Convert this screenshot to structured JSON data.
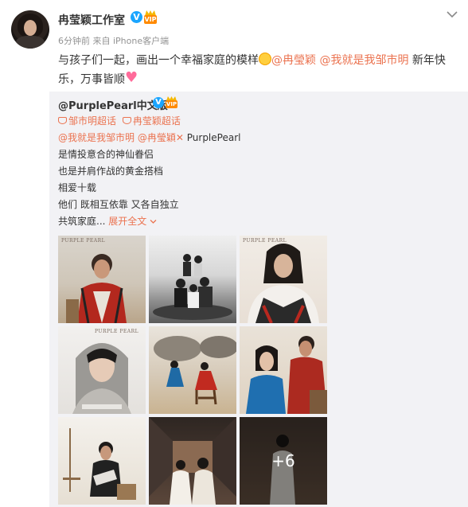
{
  "post": {
    "username": "冉莹颖工作室",
    "verified_mark": "V",
    "vip_label": "VIP",
    "timestamp": "6分钟前",
    "source": "来自 iPhone客户端",
    "text_before": "与孩子们一起，画出一个幸福家庭的模样",
    "mention_1": "@冉瑩颖",
    "mention_2": "@我就是我邹市明",
    "text_after": "新年快乐，万事皆顺"
  },
  "repost": {
    "username": "@PurplePearl中文版",
    "topic_1": "邹市明超话",
    "topic_2": "冉莹颖超话",
    "mention_1": "@我就是我邹市明",
    "mention_2": "@冉瑩穎",
    "mention_tail": "PurplePearl",
    "line_1": "是情投意合的神仙眷侣",
    "line_2": "也是并肩作战的黄金搭档",
    "line_3": "相爱十载",
    "line_4": "他们 既相互依靠 又各自独立",
    "line_5": "共筑家庭...",
    "expand_label": "展开全文",
    "watermark": "PURPLE PEARL",
    "more_count": "+6",
    "photo_watermark": "@PurplePearl中文版"
  },
  "colors": {
    "link": "#eb7350",
    "verified": "#1aa5ff",
    "repost_bg": "#f2f2f5"
  },
  "icons": [
    "verified-icon",
    "vip-icon",
    "chevron-down-icon",
    "super-topic-icon",
    "heart-emoji",
    "smile-emoji"
  ]
}
